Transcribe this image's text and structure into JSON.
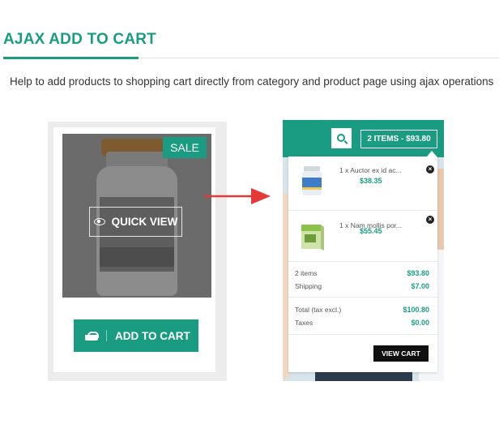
{
  "section": {
    "title": "AJAX ADD TO CART",
    "subtitle": "Help to add products to shopping cart directly from category and product page using ajax operations"
  },
  "product_card": {
    "badge": "SALE",
    "quick_view_label": "QUICK VIEW",
    "add_to_cart_label": "ADD TO CART"
  },
  "header": {
    "cart_toggle_label": "2 ITEMS - $93.80"
  },
  "cart": {
    "items": [
      {
        "name": "1 x Auctor ex id ac...",
        "price": "$38.35"
      },
      {
        "name": "1 x Nam mollis por...",
        "price": "$55.45"
      }
    ],
    "summary": {
      "items_label": "2 items",
      "items_value": "$93.80",
      "shipping_label": "Shipping",
      "shipping_value": "$7.00",
      "total_label": "Total (tax excl.)",
      "total_value": "$100.80",
      "taxes_label": "Taxes",
      "taxes_value": "$0.00"
    },
    "view_cart_label": "VIEW CART"
  },
  "colors": {
    "accent": "#1a9c82",
    "arrow": "#e53935",
    "dark_button": "#111111"
  }
}
